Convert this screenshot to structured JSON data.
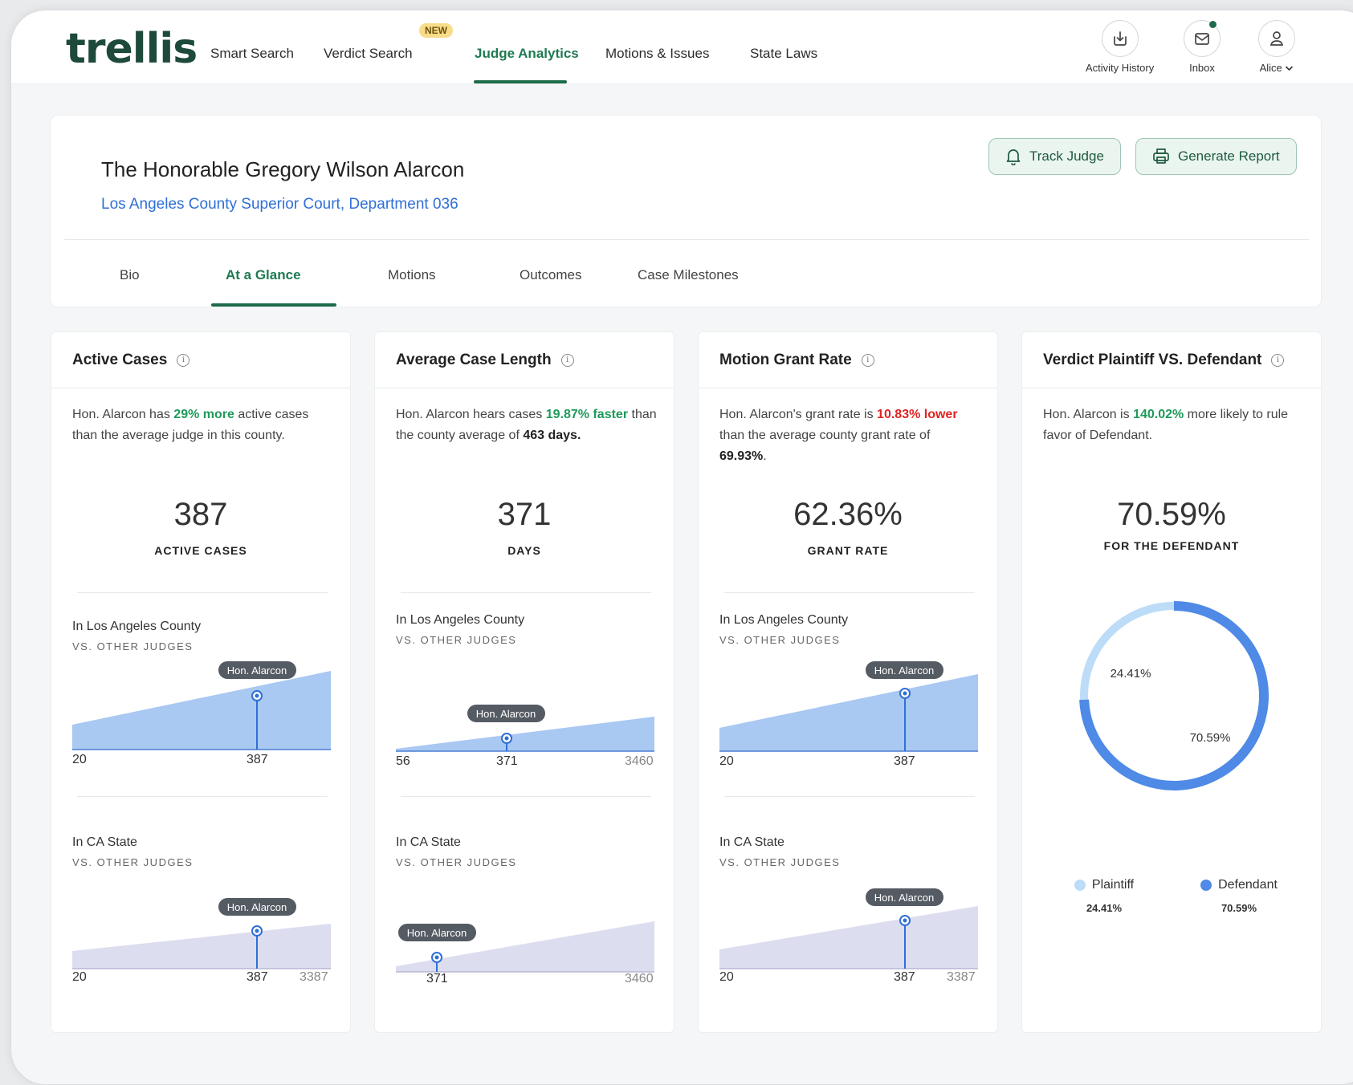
{
  "app": {
    "logo": "trellis",
    "nav": [
      "Smart Search",
      "Verdict Search",
      "Judge Analytics",
      "Motions & Issues",
      "State Laws"
    ],
    "new_badge": "NEW",
    "utilities": {
      "activity": "Activity History",
      "inbox": "Inbox",
      "user": "Alice"
    }
  },
  "judge": {
    "name": "The Honorable Gregory Wilson Alarcon",
    "court": "Los Angeles County Superior Court, Department 036",
    "track_button": "Track Judge",
    "report_button": "Generate Report"
  },
  "tabs": [
    "Bio",
    "At a Glance",
    "Motions",
    "Outcomes",
    "Case Milestones"
  ],
  "cards": {
    "active": {
      "title": "Active Cases",
      "desc_a": "Hon. Alarcon has ",
      "desc_hl": "29% more",
      "desc_b": " active cases than the average judge in this county.",
      "value": "387",
      "caption": "ACTIVE CASES",
      "county_title": "In Los Angeles County",
      "state_title": "In CA State",
      "sub": "VS. OTHER JUDGES",
      "tooltip": "Hon. Alarcon",
      "county_axis": [
        "20",
        "387"
      ],
      "state_axis": [
        "20",
        "387",
        "3387"
      ]
    },
    "length": {
      "title": "Average Case Length",
      "desc_a": "Hon. Alarcon hears cases ",
      "desc_hl": "19.87% faster",
      "desc_b": " than the county average of ",
      "desc_strong": "463 days.",
      "value": "371",
      "caption": "DAYS",
      "county_title": "In Los Angeles County",
      "state_title": "In CA State",
      "sub": "VS. OTHER JUDGES",
      "tooltip": "Hon. Alarcon",
      "county_axis": [
        "56",
        "371",
        "3460"
      ],
      "state_axis": [
        "371",
        "3460"
      ]
    },
    "grant": {
      "title": "Motion Grant Rate",
      "desc_a": "Hon. Alarcon's grant rate is ",
      "desc_hl": "10.83% lower",
      "desc_b": " than the average county grant rate of ",
      "desc_strong": "69.93%",
      "desc_end": ".",
      "value": "62.36%",
      "caption": "GRANT RATE",
      "county_title": "In Los Angeles County",
      "state_title": "In CA State",
      "sub": "VS. OTHER JUDGES",
      "tooltip": "Hon. Alarcon",
      "county_axis": [
        "20",
        "387"
      ],
      "state_axis": [
        "20",
        "387",
        "3387"
      ]
    },
    "verdict": {
      "title": "Verdict Plaintiff VS. Defendant",
      "desc_a": "Hon. Alarcon is ",
      "desc_hl": "140.02%",
      "desc_b": " more likely to rule favor of Defendant.",
      "value": "70.59%",
      "caption": "FOR THE DEFENDANT",
      "legend": [
        {
          "label": "Plaintiff",
          "value": "24.41%"
        },
        {
          "label": "Defendant",
          "value": "70.59%"
        }
      ]
    }
  },
  "chart_data": [
    {
      "type": "pie",
      "categories": [
        "Plaintiff",
        "Defendant"
      ],
      "values": [
        24.41,
        70.59
      ],
      "colors": [
        "#bcdcf8",
        "#4e8ae6"
      ]
    }
  ],
  "colors": {
    "brand": "#1d4a3a",
    "accent": "#1f7a52",
    "county_fill": "#a9c8f2",
    "state_fill": "#ddddf0",
    "plaintiff": "#bcdcf8",
    "defendant": "#4e8ae6"
  }
}
